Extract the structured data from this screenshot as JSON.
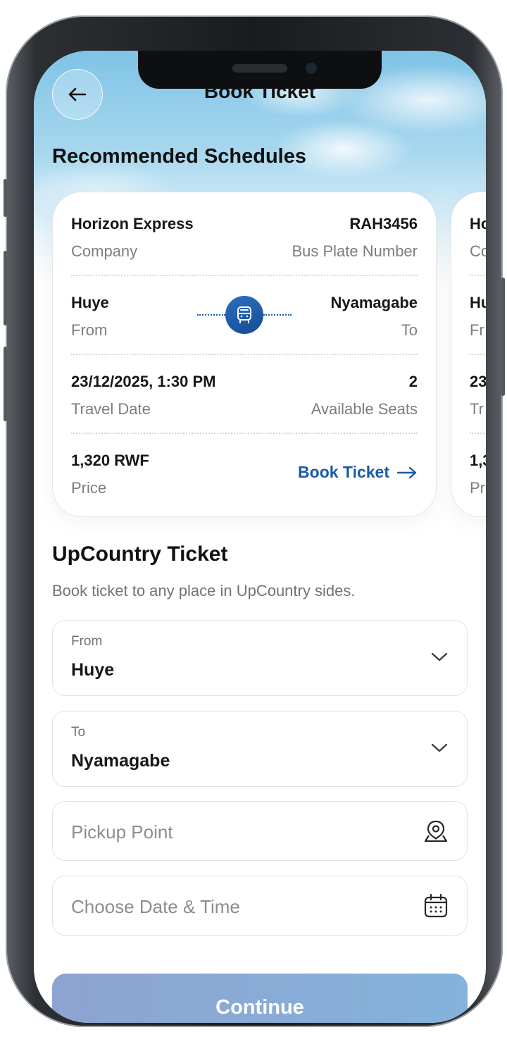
{
  "header": {
    "title": "Book Ticket"
  },
  "recommended": {
    "title": "Recommended Schedules",
    "cards": [
      {
        "company": "Horizon Express",
        "company_label": "Company",
        "plate": "RAH3456",
        "plate_label": "Bus Plate Number",
        "from": "Huye",
        "from_label": "From",
        "to": "Nyamagabe",
        "to_label": "To",
        "travel_date": "23/12/2025, 1:30 PM",
        "travel_date_label": "Travel Date",
        "seats": "2",
        "seats_label": "Available Seats",
        "price": "1,320 RWF",
        "price_label": "Price",
        "book_label": "Book Ticket"
      },
      {
        "company": "Ho",
        "company_label": "Co",
        "from": "Hu",
        "from_label": "Fr",
        "travel_date": "23",
        "travel_date_label": "Tr",
        "price": "1,3",
        "price_label": "Pr"
      }
    ]
  },
  "upcountry": {
    "title": "UpCountry Ticket",
    "subtitle": "Book ticket to any place in UpCountry sides.",
    "from": {
      "label": "From",
      "value": "Huye"
    },
    "to": {
      "label": "To",
      "value": "Nyamagabe"
    },
    "pickup": {
      "placeholder": "Pickup Point",
      "icon": "map-pin-icon"
    },
    "datetime": {
      "placeholder": "Choose Date & Time",
      "icon": "calendar-icon"
    },
    "continue_label": "Continue"
  },
  "colors": {
    "accent": "#1a5ba6",
    "continue_bg": "#8ea3d1"
  }
}
